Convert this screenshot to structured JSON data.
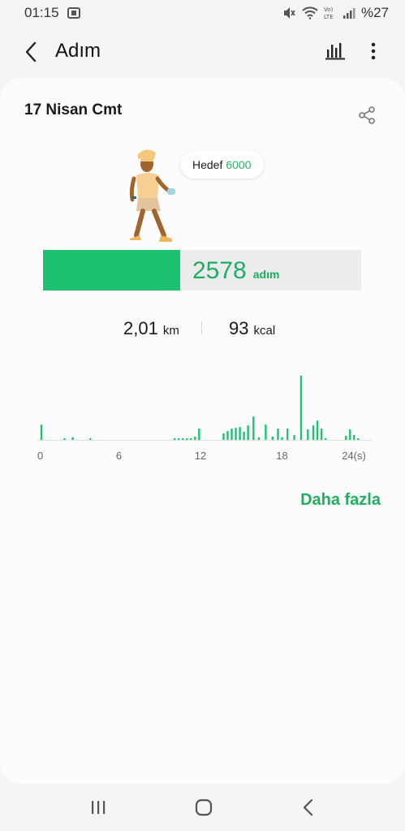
{
  "status_bar": {
    "time": "01:15",
    "battery": "%27",
    "icons": [
      "screenshot-icon",
      "mute-icon",
      "wifi-icon",
      "volte-icon",
      "signal-icon"
    ]
  },
  "app_bar": {
    "title": "Adım",
    "back_icon": "back-arrow-icon",
    "stats_icon": "bar-chart-icon",
    "menu_icon": "more-vertical-icon"
  },
  "summary": {
    "date": "17 Nisan Cmt",
    "goal_label": "Hedef",
    "goal_value": "6000",
    "steps": "2578",
    "steps_unit": "adım",
    "progress_fraction": 0.43,
    "distance_value": "2,01",
    "distance_unit": "km",
    "calories_value": "93",
    "calories_unit": "kcal"
  },
  "chart_data": {
    "type": "bar",
    "x_ticks": [
      "0",
      "6",
      "12",
      "18",
      "24(s)"
    ],
    "xlim": [
      0,
      24
    ],
    "x": [
      0.3,
      2.0,
      2.6,
      3.9,
      10.1,
      10.4,
      10.7,
      11.0,
      11.3,
      11.6,
      11.9,
      13.7,
      14.0,
      14.3,
      14.6,
      14.9,
      15.2,
      15.5,
      15.9,
      16.3,
      16.8,
      17.3,
      17.7,
      18.0,
      18.4,
      18.9,
      19.4,
      19.9,
      20.3,
      20.6,
      20.9,
      21.2,
      22.7,
      23.0,
      23.3,
      23.6
    ],
    "values": [
      19,
      2,
      3,
      2,
      2,
      2,
      2,
      2,
      2,
      4,
      14,
      8,
      11,
      14,
      15,
      16,
      10,
      18,
      29,
      3,
      19,
      4,
      14,
      3,
      14,
      6,
      80,
      13,
      18,
      24,
      14,
      2,
      5,
      13,
      6,
      2
    ],
    "ylim": [
      0,
      85
    ],
    "color": "#1dc270",
    "baseline_color": "#e0e0e0"
  },
  "more_link": "Daha fazla",
  "nav_bar": {
    "recent_icon": "recent-apps-icon",
    "home_icon": "home-icon",
    "back_icon": "nav-back-icon"
  },
  "colors": {
    "accent": "#1dc270",
    "accent_text": "#1dae62",
    "track": "#ececec",
    "card": "#fcfcfc",
    "background": "#f5f5f5"
  }
}
